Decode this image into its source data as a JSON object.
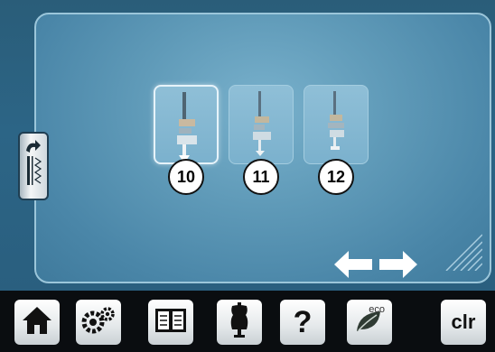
{
  "main": {
    "feet": [
      {
        "number": "10",
        "selected": true,
        "icon": "presser-foot-10-icon"
      },
      {
        "number": "11",
        "selected": false,
        "icon": "presser-foot-11-icon"
      },
      {
        "number": "12",
        "selected": false,
        "icon": "presser-foot-12-icon"
      }
    ],
    "back_icon": "stitch-back-icon",
    "arrows": [
      "arrow-left-icon",
      "arrow-right-icon"
    ]
  },
  "taskbar": {
    "buttons": [
      {
        "name": "home-button",
        "icon": "home-icon"
      },
      {
        "name": "settings-button",
        "icon": "gears-icon"
      },
      {
        "name": "tutorial-button",
        "icon": "book-icon"
      },
      {
        "name": "creative-consultant-button",
        "icon": "dress-form-icon"
      },
      {
        "name": "help-button",
        "icon": "question-mark-icon",
        "label": "?"
      },
      {
        "name": "eco-button",
        "icon": "leaf-icon",
        "label": "eco"
      },
      {
        "name": "clear-button",
        "icon": "clear-icon",
        "label": "clr"
      }
    ]
  },
  "colors": {
    "panel": "#5f9ab8",
    "tile": "#7bb1cd",
    "background": "#2a5d79"
  }
}
